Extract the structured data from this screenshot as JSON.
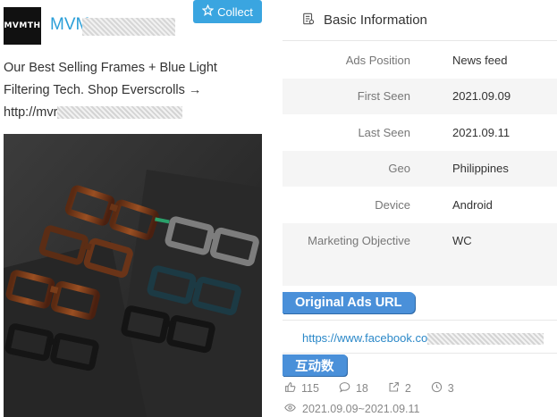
{
  "brand": {
    "logo_text": "MVMTH",
    "name": "MVM"
  },
  "collect_button": {
    "label": "Collect",
    "icon": "star-outline-icon"
  },
  "ad": {
    "text_line1": "Our Best Selling Frames + Blue Light",
    "text_line2": "Filtering Tech. Shop Everscrolls →",
    "url_prefix": "http://mvr"
  },
  "basic_info": {
    "title": "Basic Information",
    "rows": [
      {
        "label": "Ads Position",
        "value": "News feed"
      },
      {
        "label": "First Seen",
        "value": "2021.09.09"
      },
      {
        "label": "Last Seen",
        "value": "2021.09.11"
      },
      {
        "label": "Geo",
        "value": "Philippines"
      },
      {
        "label": "Device",
        "value": "Android"
      },
      {
        "label": "Marketing Objective",
        "value": "WC"
      }
    ]
  },
  "original_url": {
    "tag": "Original Ads URL",
    "url_prefix": "https://www.facebook.co"
  },
  "interaction": {
    "tag": "互动数",
    "likes": "115",
    "comments": "18",
    "shares": "2",
    "views": "3",
    "date_range": "2021.09.09~2021.09.11"
  },
  "colors": {
    "accent": "#3aa5e0",
    "tag_blue": "#4a90d9",
    "link": "#2b88c8"
  }
}
